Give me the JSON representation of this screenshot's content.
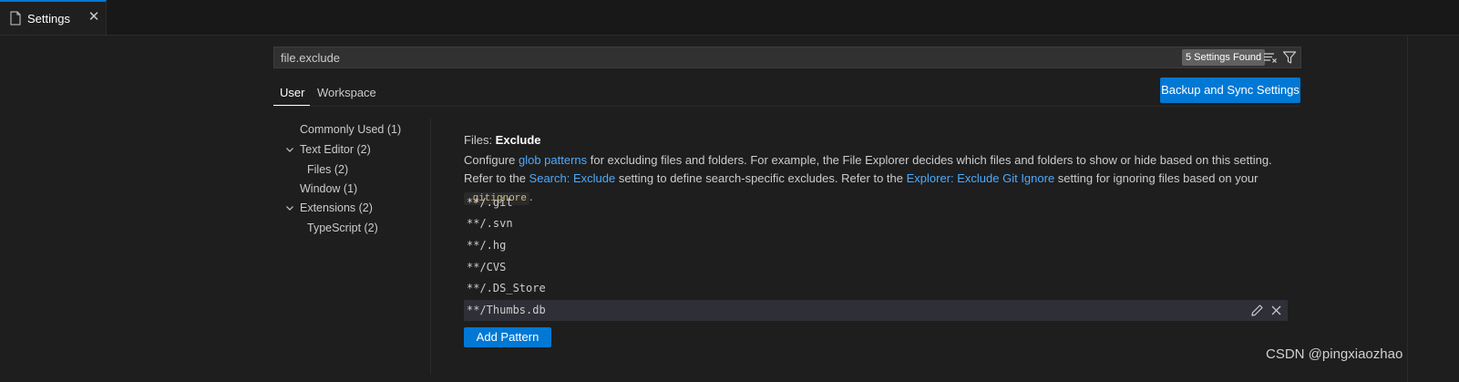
{
  "tab": {
    "label": "Settings",
    "icon": "file-icon",
    "close_glyph": "✕"
  },
  "search": {
    "value": "file.exclude",
    "result_count": "5 Settings Found"
  },
  "scopes": {
    "user": "User",
    "workspace": "Workspace"
  },
  "sync_button": "Backup and Sync Settings",
  "toc": [
    {
      "label": "Commonly Used (1)",
      "expanded": null
    },
    {
      "label": "Text Editor (2)",
      "expanded": true
    },
    {
      "label": "Files (2)",
      "expanded": null
    },
    {
      "label": "Window (1)",
      "expanded": null
    },
    {
      "label": "Extensions (2)",
      "expanded": true
    },
    {
      "label": "TypeScript (2)",
      "expanded": null
    }
  ],
  "setting": {
    "category": "Files: ",
    "name": "Exclude",
    "desc_1": "Configure ",
    "link_glob": "glob patterns",
    "desc_2": " for excluding files and folders. For example, the File Explorer decides which files and folders to show or hide based on this setting. Refer to the ",
    "link_search": "Search: Exclude",
    "desc_3": " setting to define search-specific excludes. Refer to the ",
    "link_explorer": "Explorer: Exclude Git Ignore",
    "desc_4": " setting for ignoring files based on your ",
    "code": ".gitignore",
    "desc_5": "."
  },
  "patterns": [
    "**/.git",
    "**/.svn",
    "**/.hg",
    "**/CVS",
    "**/.DS_Store",
    "**/Thumbs.db"
  ],
  "add_pattern_label": "Add Pattern",
  "watermark": "CSDN @pingxiaozhao",
  "colors": {
    "accent": "#0078d4",
    "link": "#4daafc",
    "background": "#1e1e1e"
  }
}
